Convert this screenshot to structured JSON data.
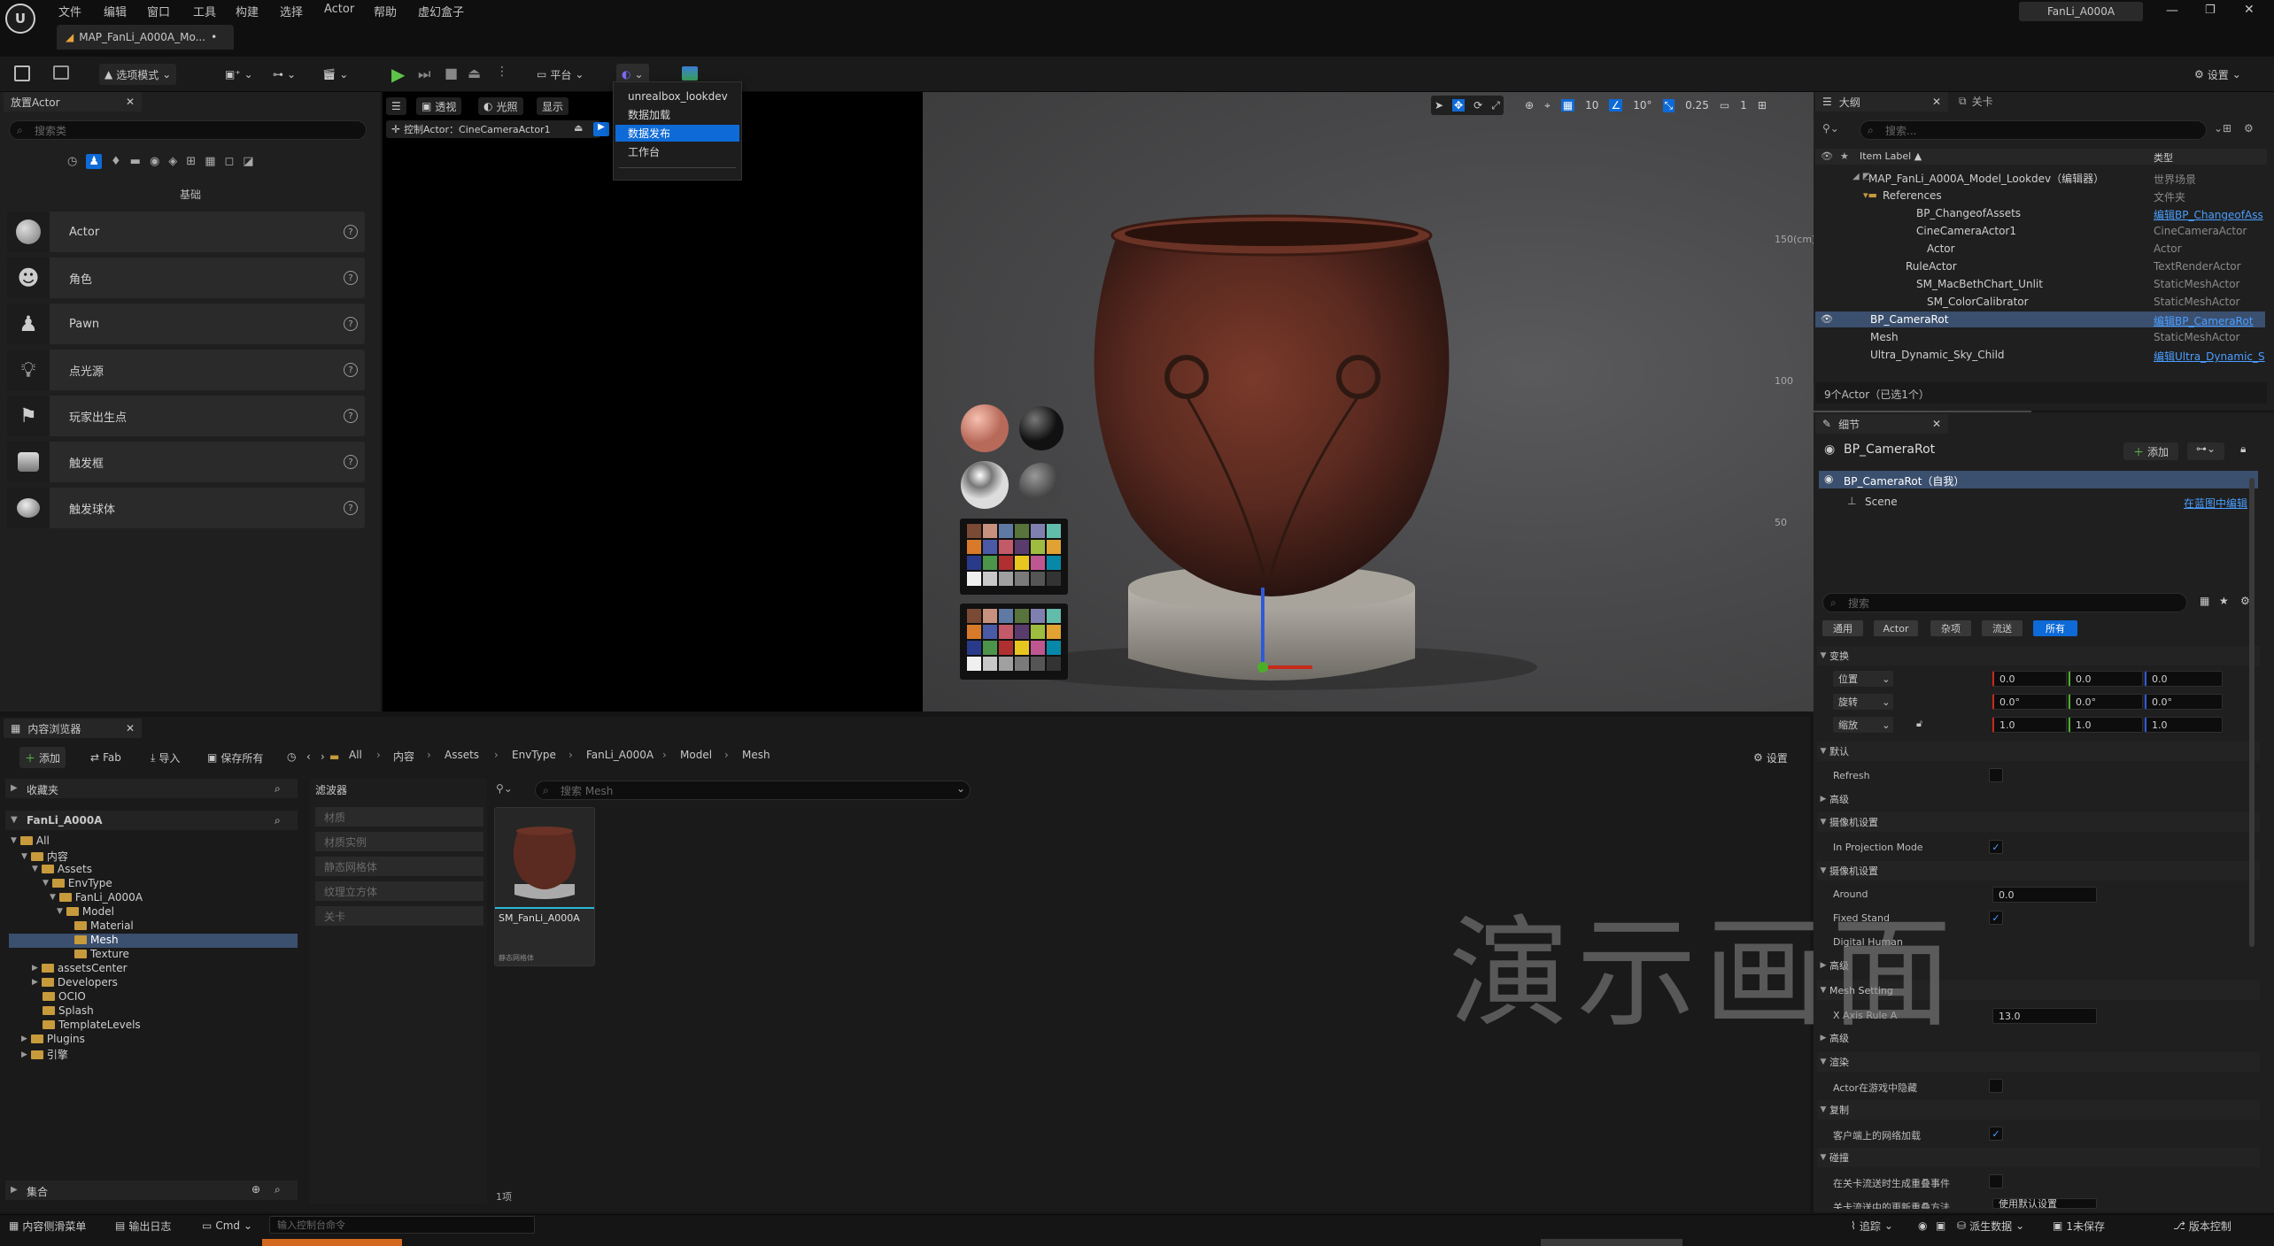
{
  "menu": [
    "文件",
    "编辑",
    "窗口",
    "工具",
    "构建",
    "选择",
    "Actor",
    "帮助",
    "虚幻盒子"
  ],
  "window": {
    "project": "FanLi_A000A",
    "tab": "MAP_FanLi_A000A_Mo...",
    "tab_mod": "•"
  },
  "toolbar": {
    "mode": "选项模式",
    "platform": "平台",
    "settings": "设置"
  },
  "dropdown": {
    "items": [
      "unrealbox_lookdev",
      "数据加载",
      "数据发布",
      "工作台"
    ],
    "selected_index": 2
  },
  "place_actors": {
    "tab": "放置Actor",
    "search_placeholder": "搜索类",
    "category": "基础",
    "items": [
      "Actor",
      "角色",
      "Pawn",
      "点光源",
      "玩家出生点",
      "触发框",
      "触发球体"
    ]
  },
  "viewport": {
    "perspective": "透视",
    "lit": "光照",
    "show": "显示",
    "pilot": "控制Actor：CineCameraActor1",
    "grid": "10",
    "angle": "10°",
    "scale": "0.25",
    "cam": "1",
    "ruler": [
      "150(cm)",
      "100",
      "50"
    ]
  },
  "outliner": {
    "tab": "大纲",
    "tab2": "关卡",
    "search_placeholder": "搜索...",
    "col_label": "Item Label ▲",
    "col_type": "类型",
    "rows": [
      {
        "name": "MAP_FanLi_A000A_Model_Lookdev（编辑器）",
        "type": "世界场景",
        "link": false
      },
      {
        "name": "References",
        "type": "文件夹",
        "link": false
      },
      {
        "name": "BP_ChangeofAssets",
        "type": "编辑BP_ChangeofAss",
        "link": true
      },
      {
        "name": "CineCameraActor1",
        "type": "CineCameraActor",
        "link": false
      },
      {
        "name": "Actor",
        "type": "Actor",
        "link": false
      },
      {
        "name": "RuleActor",
        "type": "TextRenderActor",
        "link": false
      },
      {
        "name": "SM_MacBethChart_Unlit",
        "type": "StaticMeshActor",
        "link": false
      },
      {
        "name": "SM_ColorCalibrator",
        "type": "StaticMeshActor",
        "link": false
      },
      {
        "name": "BP_CameraRot",
        "type": "编辑BP_CameraRot",
        "link": true
      },
      {
        "name": "Mesh",
        "type": "StaticMeshActor",
        "link": false
      },
      {
        "name": "Ultra_Dynamic_Sky_Child",
        "type": "编辑Ultra_Dynamic_S",
        "link": true
      }
    ],
    "count": "9个Actor（已选1个）"
  },
  "details": {
    "tab": "细节",
    "title": "BP_CameraRot",
    "add": "添加",
    "self": "BP_CameraRot（自我）",
    "scene": "Scene",
    "edit_bp": "在蓝图中编辑",
    "search_placeholder": "搜索",
    "filters": [
      "通用",
      "Actor",
      "杂项",
      "流送",
      "所有"
    ],
    "transform": {
      "section": "变换",
      "location": "位置",
      "rotation": "旋转",
      "scale": "缩放",
      "loc": [
        "0.0",
        "0.0",
        "0.0"
      ],
      "rot": [
        "0.0°",
        "0.0°",
        "0.0°"
      ],
      "scl": [
        "1.0",
        "1.0",
        "1.0"
      ]
    },
    "default": "默认",
    "refresh": "Refresh",
    "advanced": "高级",
    "camera_settings": "摄像机设置",
    "projection": "In Projection Mode",
    "camera_settings2": "摄像机设置",
    "around": "Around",
    "around_val": "0.0",
    "fixed_stand": "Fixed Stand",
    "digital_human": "Digital Human",
    "advanced2": "高级",
    "mesh_setting": "Mesh Setting",
    "x_axis": "X Axis Rule A",
    "x_axis_val": "13.0",
    "advanced3": "高级",
    "render": "渲染",
    "hidden_in_game": "Actor在游戏中隐藏",
    "replication": "复制",
    "net_load": "客户端上的网络加载",
    "collision": "碰撞",
    "overlap": "在关卡流送时生成重叠事件",
    "more": "关卡流送中的更新重叠方法",
    "more_val": "使用默认设置"
  },
  "content_browser": {
    "tab": "内容浏览器",
    "add": "添加",
    "fab": "Fab",
    "import": "导入",
    "save_all": "保存所有",
    "breadcrumb": [
      "All",
      "内容",
      "Assets",
      "EnvType",
      "FanLi_A000A",
      "Model",
      "Mesh"
    ],
    "settings": "设置",
    "favorites": "收藏夹",
    "root": "FanLi_A000A",
    "filter_title": "滤波器",
    "filters": [
      "材质",
      "材质实例",
      "静态网格体",
      "纹理立方体",
      "关卡"
    ],
    "search_placeholder": "搜索 Mesh",
    "tree": [
      "All",
      "内容",
      "Assets",
      "EnvType",
      "FanLi_A000A",
      "Model",
      "Material",
      "Mesh",
      "Texture",
      "assetsCenter",
      "Developers",
      "OCIO",
      "Splash",
      "TemplateLevels",
      "Plugins",
      "引擎"
    ],
    "asset_name": "SM_FanLi_A000A",
    "asset_type": "静态网格体",
    "count": "1项",
    "collections": "集合"
  },
  "status": {
    "drawer": "内容侧滑菜单",
    "log": "输出日志",
    "cmd": "Cmd",
    "cmd_placeholder": "输入控制台命令",
    "trace": "追踪",
    "derived": "派生数据",
    "unsaved": "1未保存",
    "vcs": "版本控制"
  },
  "watermark": "演示画面",
  "colors": {
    "accent": "#0e6ad6",
    "link": "#4a9eff",
    "selection": "#3b4f6e"
  }
}
